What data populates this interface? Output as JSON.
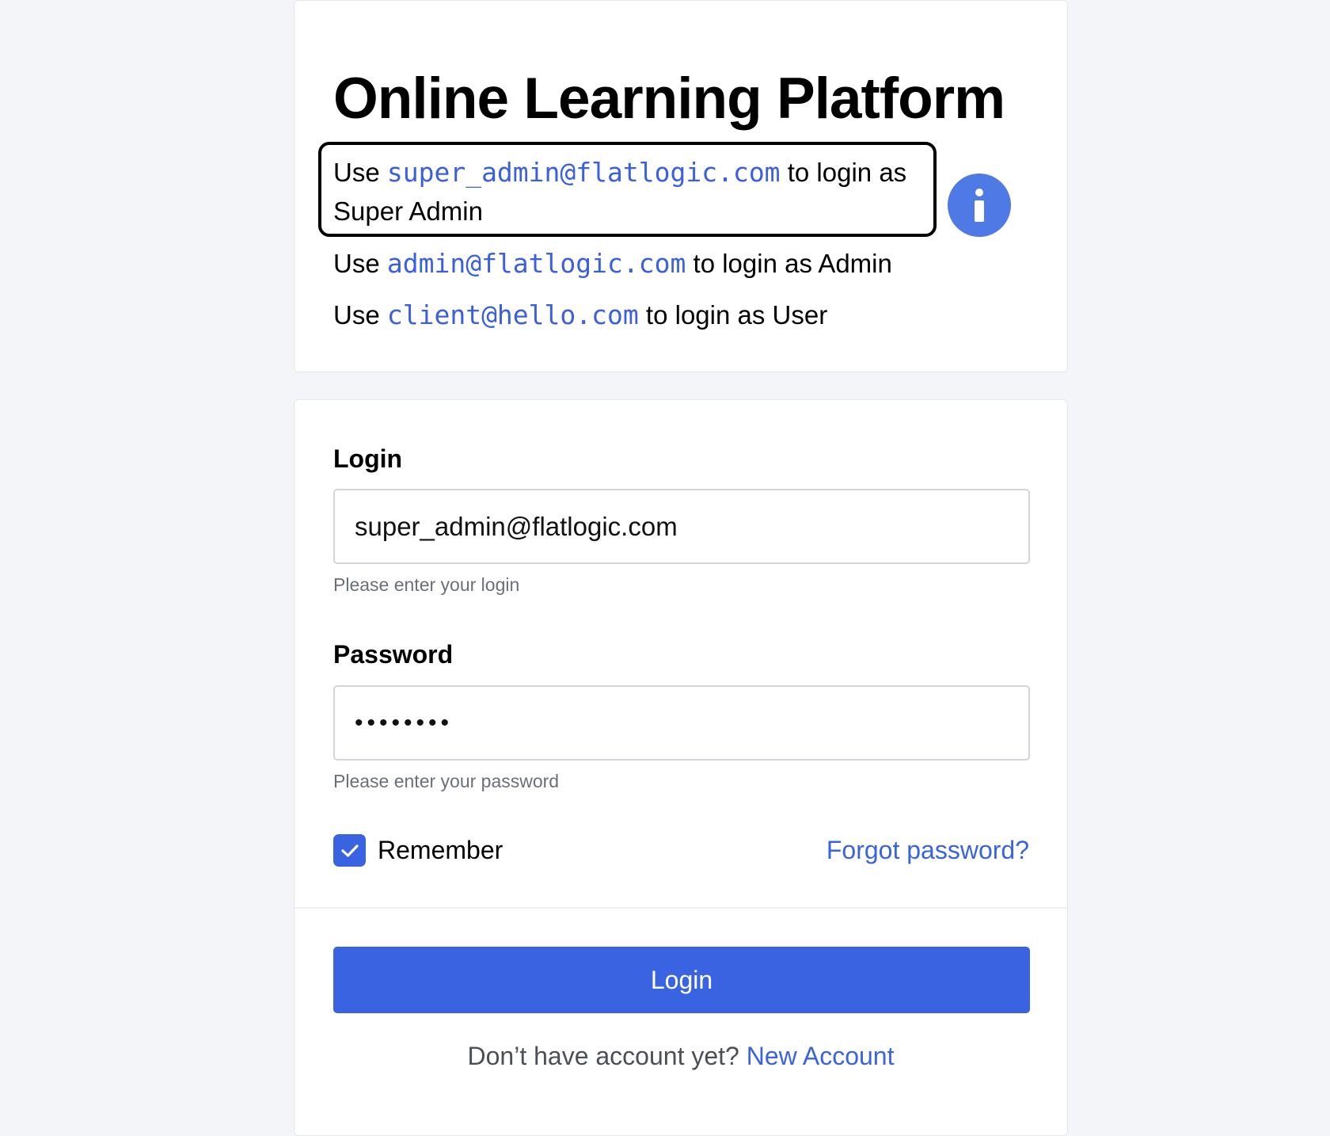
{
  "app": {
    "title": "Online Learning Platform"
  },
  "hints": [
    {
      "prefix": "Use",
      "email": "super_admin@flatlogic.com",
      "suffix": "to login as Super Admin"
    },
    {
      "prefix": "Use",
      "email": "admin@flatlogic.com",
      "suffix": "to login as Admin"
    },
    {
      "prefix": "Use",
      "email": "client@hello.com",
      "suffix": "to login as User"
    }
  ],
  "info_icon": "info-icon",
  "form": {
    "login_label": "Login",
    "login_value": "super_admin@flatlogic.com",
    "login_help": "Please enter your login",
    "password_label": "Password",
    "password_value": "••••••••",
    "password_help": "Please enter your password",
    "remember_label": "Remember",
    "remember_checked": true,
    "forgot_link": "Forgot password?",
    "submit_label": "Login",
    "signup_prompt": "Don’t have account yet?",
    "signup_link": "New Account"
  },
  "colors": {
    "accent": "#3a63e2",
    "info_icon": "#4f7ae6",
    "background": "#f4f5f8"
  }
}
